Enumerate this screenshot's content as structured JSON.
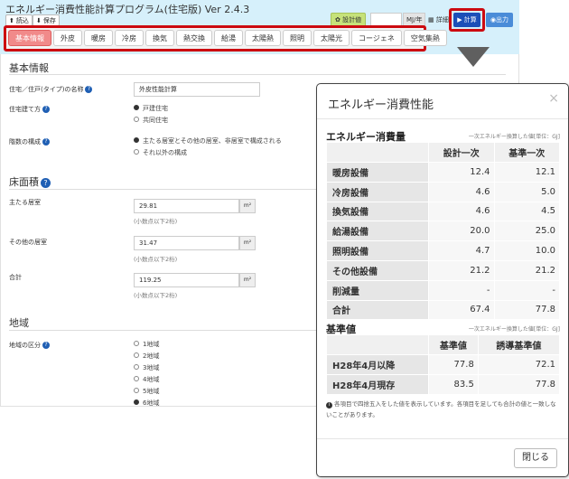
{
  "header": {
    "title": "エネルギー消費性能計算プログラム(住宅版) Ver 2.4.3",
    "load_label": "読込",
    "save_label": "保存",
    "design_label": "設計値",
    "unit_label": "MJ/年",
    "detail_label": "詳細",
    "calc_label": "▶ 計算",
    "output_label": "出力"
  },
  "tabs": [
    "基本情報",
    "外皮",
    "暖房",
    "冷房",
    "換気",
    "熱交換",
    "給湯",
    "太陽熱",
    "照明",
    "太陽光",
    "コージェネ",
    "空気集熱"
  ],
  "basic": {
    "section_title": "基本情報",
    "name_label": "住宅／住戸(タイプ)の名称",
    "name_value": "外皮性能計算",
    "building_label": "住宅建て方",
    "building_options": [
      "戸建住宅",
      "共同住宅"
    ],
    "floor_label": "階数の構成",
    "floor_options": [
      "主たる居室とその他の居室、非居室で構成される",
      "それ以外の構成"
    ]
  },
  "floor": {
    "section_title": "床面積",
    "main_label": "主たる居室",
    "main_value": "29.81",
    "other_label": "その他の居室",
    "other_value": "31.47",
    "total_label": "合計",
    "total_value": "119.25",
    "unit": "m²",
    "hint": "(小数点以下2桁)"
  },
  "region": {
    "section_title": "地域",
    "label": "地域の区分",
    "options": [
      "1地域",
      "2地域",
      "3地域",
      "4地域",
      "5地域",
      "6地域"
    ]
  },
  "modal": {
    "title": "エネルギー消費性能",
    "close_x": "×",
    "energy_head": "エネルギー消費量",
    "energy_note": "一次エネルギー換算した値[単位：GJ]",
    "energy_cols": [
      "設計一次",
      "基準一次"
    ],
    "energy_rows": [
      {
        "label": "暖房設備",
        "a": "12.4",
        "b": "12.1"
      },
      {
        "label": "冷房設備",
        "a": "4.6",
        "b": "5.0"
      },
      {
        "label": "換気設備",
        "a": "4.6",
        "b": "4.5"
      },
      {
        "label": "給湯設備",
        "a": "20.0",
        "b": "25.0"
      },
      {
        "label": "照明設備",
        "a": "4.7",
        "b": "10.0"
      },
      {
        "label": "その他設備",
        "a": "21.2",
        "b": "21.2"
      },
      {
        "label": "削減量",
        "a": "-",
        "b": "-"
      },
      {
        "label": "合計",
        "a": "67.4",
        "b": "77.8"
      }
    ],
    "std_head": "基準値",
    "std_note": "一次エネルギー換算した値[単位：GJ]",
    "std_cols": [
      "基準値",
      "誘導基準値"
    ],
    "std_rows": [
      {
        "label": "H28年4月以降",
        "a": "77.8",
        "b": "72.1"
      },
      {
        "label": "H28年4月現存",
        "a": "83.5",
        "b": "77.8"
      }
    ],
    "footnote": "各項目で四捨五入をした値を表示しています。各項目を足しても合計の値と一致しないことがあります。",
    "close_label": "閉じる"
  }
}
